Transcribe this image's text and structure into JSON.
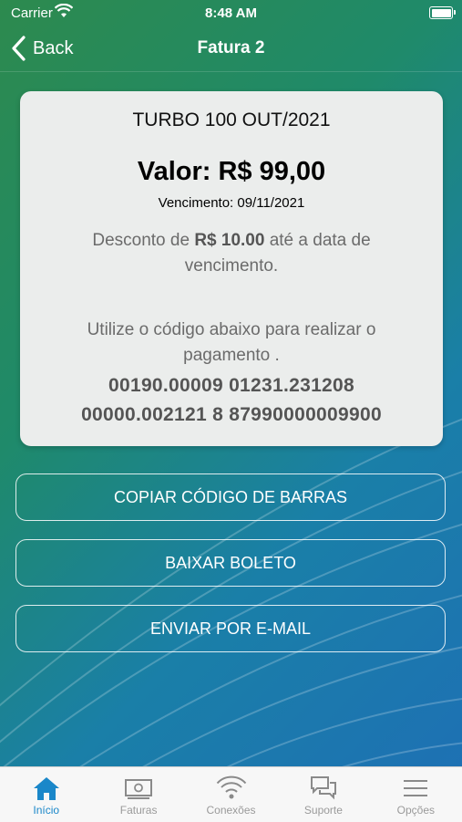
{
  "status": {
    "carrier": "Carrier",
    "time": "8:48 AM"
  },
  "nav": {
    "back_label": "Back",
    "title": "Fatura 2"
  },
  "invoice": {
    "plan": "TURBO 100 OUT/2021",
    "valor": "Valor: R$ 99,00",
    "vencimento": "Vencimento: 09/11/2021",
    "desconto_prefix": "Desconto de ",
    "desconto_amount": "R$ 10.00",
    "desconto_suffix": " até a data de vencimento.",
    "instruction": "Utilize o código abaixo para realizar o pagamento .",
    "barcode_line1": "00190.00009 01231.231208",
    "barcode_line2": "00000.002121 8 87990000009900"
  },
  "actions": {
    "copy": "COPIAR CÓDIGO DE BARRAS",
    "download": "BAIXAR BOLETO",
    "email": "ENVIAR POR E-MAIL"
  },
  "tabs": [
    {
      "label": "Início",
      "icon": "home-icon",
      "active": true
    },
    {
      "label": "Faturas",
      "icon": "money-icon",
      "active": false
    },
    {
      "label": "Conexões",
      "icon": "wifi-icon",
      "active": false
    },
    {
      "label": "Suporte",
      "icon": "chat-icon",
      "active": false
    },
    {
      "label": "Opções",
      "icon": "menu-icon",
      "active": false
    }
  ],
  "colors": {
    "accent": "#1a87c9",
    "card": "#ebedec"
  }
}
